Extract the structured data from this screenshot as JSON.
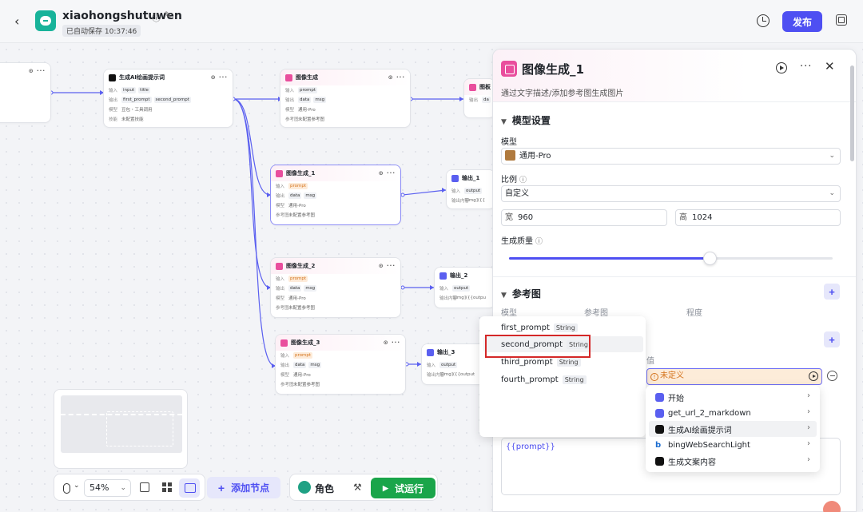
{
  "header": {
    "title": "xiaohongshutuwen",
    "autosave": "已自动保存 10:37:46",
    "publish_label": "发布"
  },
  "canvas": {
    "nodes": {
      "left_partial": {},
      "prompt_node": {
        "title": "生成AI绘画提示词",
        "row1_label": "输入",
        "row1_vals": [
          "input",
          "title"
        ],
        "row2_label": "输出",
        "row2_vals": [
          "first_prompt",
          "second_prompt"
        ],
        "row3_label": "模型",
        "row3_val": "豆包・工具调用",
        "row4_label": "技能",
        "row4_val": "未配置技能"
      },
      "img_gen": {
        "title": "图像生成",
        "row1_label": "输入",
        "row1_val": "prompt",
        "row2_label": "输出",
        "row2_vals": [
          "data",
          "msg"
        ],
        "row3_label": "模型",
        "row3_val": "通用-Pro",
        "row4_label": "参考图",
        "row4_val": "未配置参考图"
      },
      "img_gen_peek": {
        "title": "图板",
        "row_label": "输出",
        "row_val": "da"
      },
      "img_gen_1": {
        "title": "图像生成_1",
        "row1_label": "输入",
        "row1_val": "prompt",
        "row2_label": "输出",
        "row2_vals": [
          "data",
          "msg"
        ],
        "row3_label": "模型",
        "row3_val": "通用-Pro",
        "row4_label": "参考图",
        "row4_val": "未配置参考图"
      },
      "img_gen_2": {
        "title": "图像生成_2",
        "row1_label": "输入",
        "row1_val": "prompt",
        "row2_label": "输出",
        "row2_vals": [
          "data",
          "msg"
        ],
        "row3_label": "模型",
        "row3_val": "通用-Pro",
        "row4_label": "参考图",
        "row4_val": "未配置参考图"
      },
      "img_gen_3": {
        "title": "图像生成_3",
        "row1_label": "输入",
        "row1_val": "prompt",
        "row2_label": "输出",
        "row2_vals": [
          "data",
          "msg"
        ],
        "row3_label": "模型",
        "row3_val": "通用-Pro",
        "row4_label": "参考图",
        "row4_val": "未配置参考图"
      },
      "out_1": {
        "title": "输出_1",
        "row1_label": "输入",
        "row1_val": "output",
        "row2_label": "输出内容",
        "row2_val": "![img]({{"
      },
      "out_2": {
        "title": "输出_2",
        "row1_label": "输入",
        "row1_val": "output",
        "row2_label": "输出内容",
        "row2_val": "![img]({{outpu"
      },
      "out_3": {
        "title": "输出_3",
        "row1_label": "输入",
        "row1_val": "output",
        "row2_label": "输出内容",
        "row2_val": "![img]({{output"
      }
    }
  },
  "toolbar": {
    "zoom": "54%",
    "add_node_label": "添加节点",
    "role_label": "角色",
    "run_label": "试运行"
  },
  "panel": {
    "title": "图像生成_1",
    "description": "通过文字描述/添加参考图生成图片",
    "model_section": "模型设置",
    "model_label": "模型",
    "model_value": "通用-Pro",
    "ratio_label": "比例",
    "ratio_value": "自定义",
    "width_prefix": "宽",
    "width_value": "960",
    "height_prefix": "高",
    "height_value": "1024",
    "quality_label": "生成质量",
    "quality_level": 0.62,
    "ref_section": "参考图",
    "ref_cols": [
      "模型",
      "参考图",
      "程度"
    ],
    "value_head": "值",
    "undefined_label": "未定义",
    "prompt_text": "{{prompt}}"
  },
  "var_menu": {
    "items": [
      {
        "name": "first_prompt",
        "type": "String"
      },
      {
        "name": "second_prompt",
        "type": "String"
      },
      {
        "name": "third_prompt",
        "type": "String"
      },
      {
        "name": "fourth_prompt",
        "type": "String"
      }
    ]
  },
  "node_menu": {
    "items": [
      {
        "label": "开始",
        "icon_color": "#5a5ff0"
      },
      {
        "label": "get_url_2_markdown",
        "icon_color": "#5a5ff0"
      },
      {
        "label": "生成AI绘画提示词",
        "icon_color": "#111111"
      },
      {
        "label": "bingWebSearchLight",
        "icon_color": "#1c6dd0"
      },
      {
        "label": "生成文案内容",
        "icon_color": "#111111"
      }
    ]
  },
  "colors": {
    "accent": "#4e4ff2",
    "run_green": "#1aa54a",
    "image_node_pink": "#e94e9d",
    "warning_orange": "#d4731c",
    "highlight_red": "#d42828"
  }
}
